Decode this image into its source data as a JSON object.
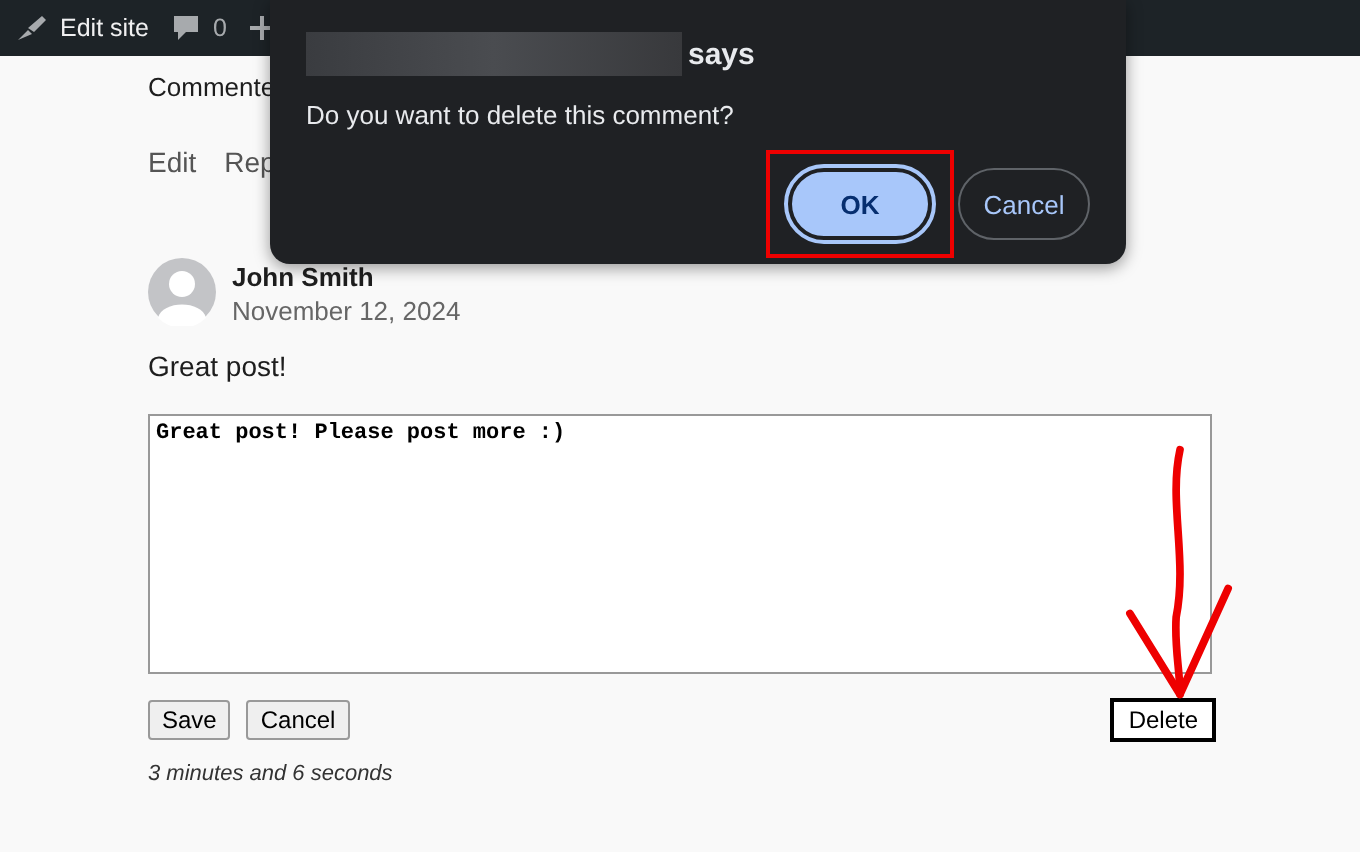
{
  "admin_bar": {
    "edit_site": "Edit site",
    "comment_count": "0"
  },
  "page": {
    "comments_label": "Commente",
    "actions": [
      "Edit",
      "Rep"
    ],
    "comment": {
      "author": "John Smith",
      "date": "November 12, 2024",
      "text": "Great post!"
    },
    "editor": {
      "value": "Great post! Please post more :)"
    },
    "buttons": [
      {
        "label": "Save",
        "kind": "plain"
      },
      {
        "label": "Cancel",
        "kind": "plain"
      }
    ],
    "delete_button": "Delete",
    "elapsed": "3 minutes and 6 seconds"
  },
  "dialog": {
    "title_suffix": "says",
    "message": "Do you want to delete this comment?",
    "buttons": [
      {
        "label": "OK",
        "kind": "primary",
        "highlighted": true
      },
      {
        "label": "Cancel",
        "kind": "secondary",
        "highlighted": false
      }
    ]
  }
}
